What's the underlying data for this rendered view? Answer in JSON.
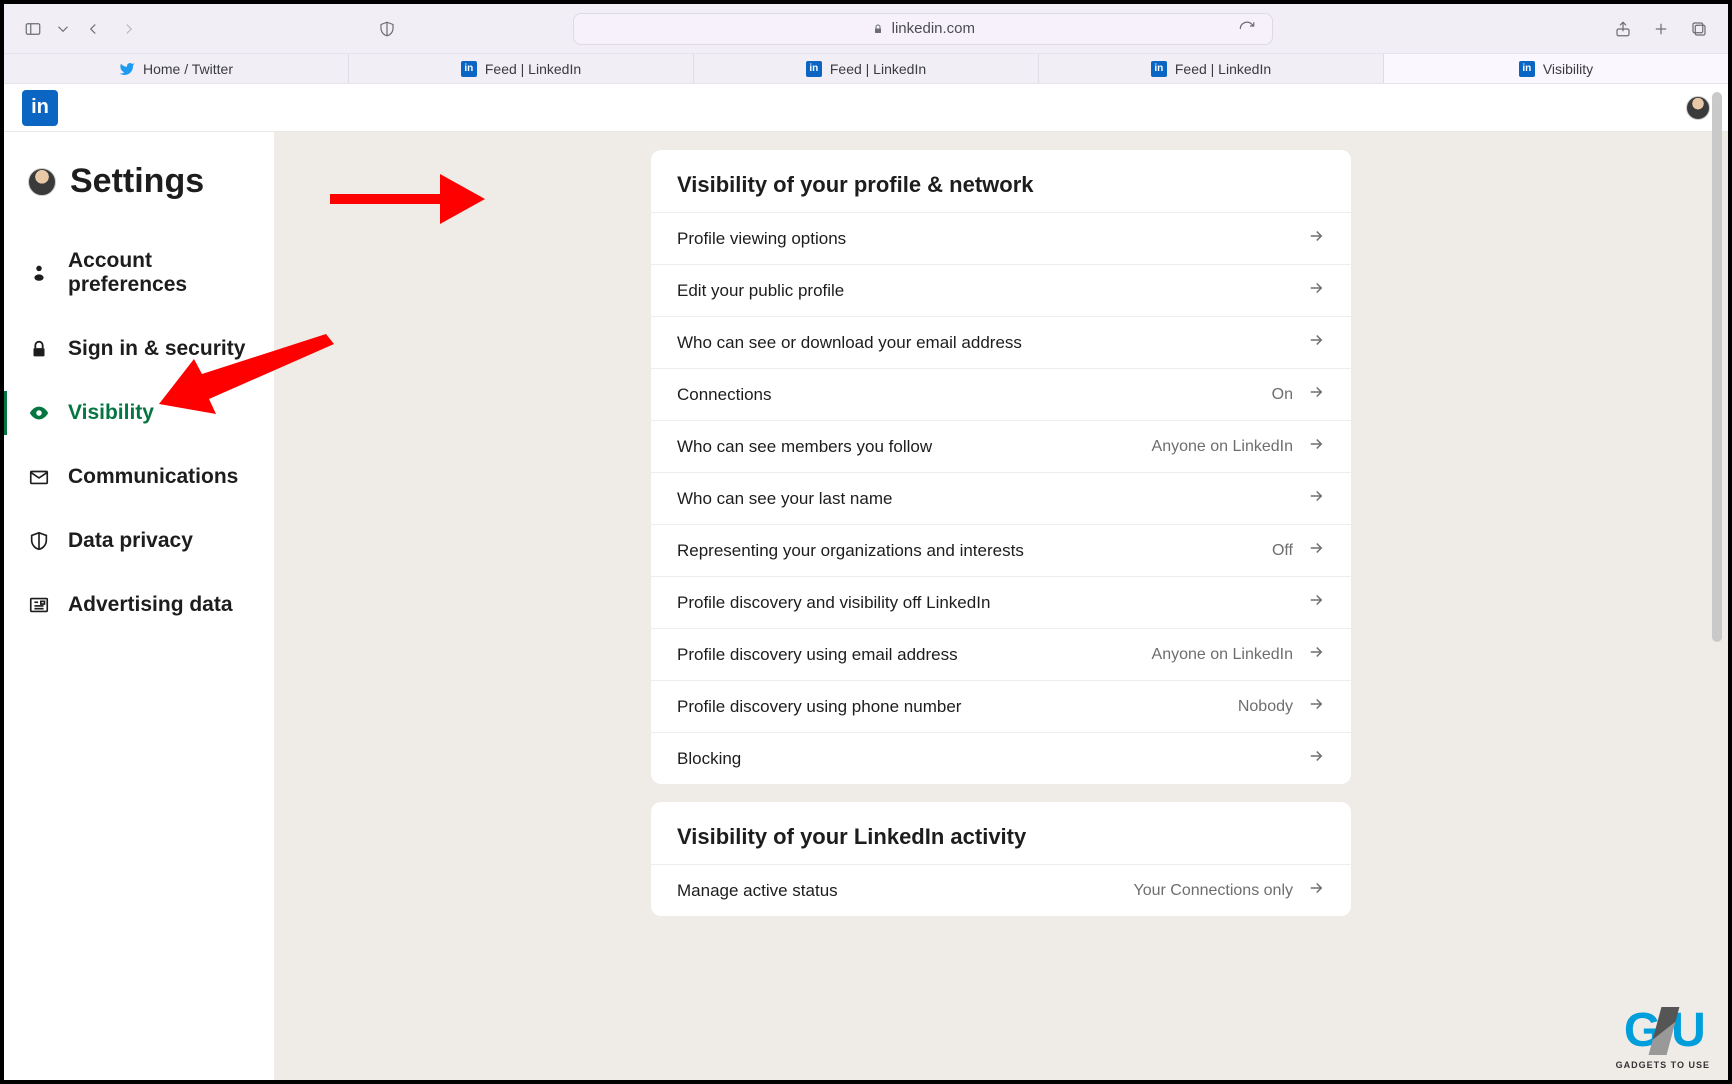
{
  "browser": {
    "address": "linkedin.com",
    "tabs": [
      {
        "label": "Home / Twitter",
        "icon": "twitter"
      },
      {
        "label": "Feed | LinkedIn",
        "icon": "linkedin"
      },
      {
        "label": "Feed | LinkedIn",
        "icon": "linkedin"
      },
      {
        "label": "Feed | LinkedIn",
        "icon": "linkedin"
      },
      {
        "label": "Visibility",
        "icon": "linkedin"
      }
    ]
  },
  "sidebar": {
    "title": "Settings",
    "items": [
      {
        "label": "Account preferences",
        "icon": "person"
      },
      {
        "label": "Sign in & security",
        "icon": "lock"
      },
      {
        "label": "Visibility",
        "icon": "eye",
        "active": true
      },
      {
        "label": "Communications",
        "icon": "mail"
      },
      {
        "label": "Data privacy",
        "icon": "shield"
      },
      {
        "label": "Advertising data",
        "icon": "news"
      }
    ]
  },
  "main": {
    "sections": [
      {
        "title": "Visibility of your profile & network",
        "rows": [
          {
            "label": "Profile viewing options",
            "value": ""
          },
          {
            "label": "Edit your public profile",
            "value": ""
          },
          {
            "label": "Who can see or download your email address",
            "value": ""
          },
          {
            "label": "Connections",
            "value": "On"
          },
          {
            "label": "Who can see members you follow",
            "value": "Anyone on LinkedIn"
          },
          {
            "label": "Who can see your last name",
            "value": ""
          },
          {
            "label": "Representing your organizations and interests",
            "value": "Off"
          },
          {
            "label": "Profile discovery and visibility off LinkedIn",
            "value": ""
          },
          {
            "label": "Profile discovery using email address",
            "value": "Anyone on LinkedIn"
          },
          {
            "label": "Profile discovery using phone number",
            "value": "Nobody"
          },
          {
            "label": "Blocking",
            "value": ""
          }
        ]
      },
      {
        "title": "Visibility of your LinkedIn activity",
        "rows": [
          {
            "label": "Manage active status",
            "value": "Your Connections only"
          }
        ]
      }
    ]
  },
  "watermark": {
    "text": "GADGETS TO USE"
  }
}
